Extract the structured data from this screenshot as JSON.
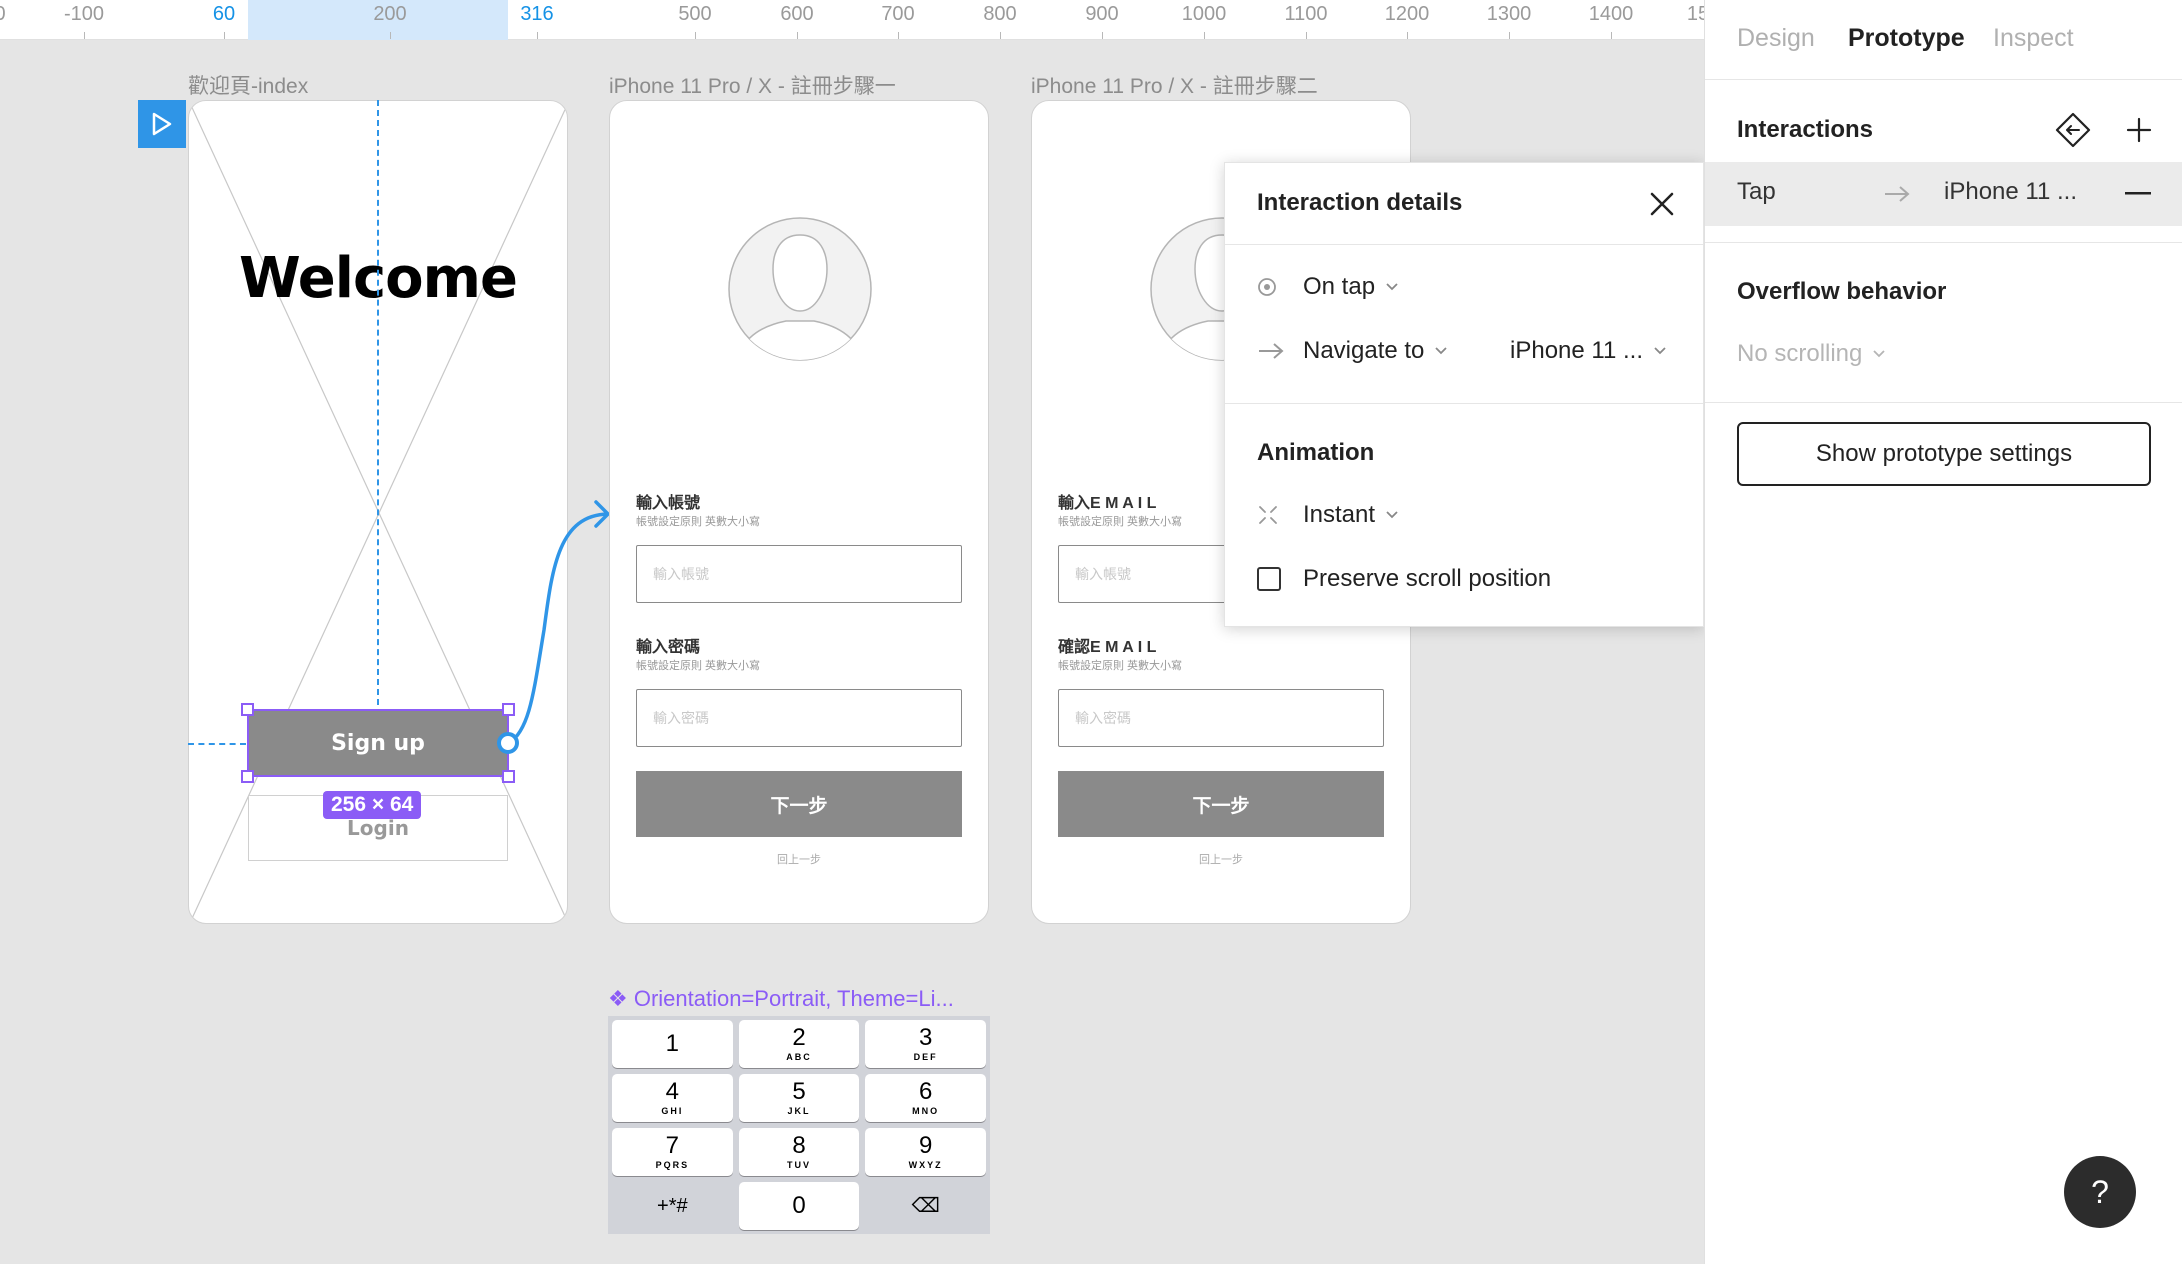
{
  "ruler": {
    "ticks": [
      "0",
      "-100",
      "60",
      "200",
      "316",
      "500",
      "600",
      "700",
      "800",
      "900",
      "1000",
      "1100",
      "1200",
      "1300",
      "1400",
      "15"
    ]
  },
  "frames": {
    "welcome": {
      "title": "歡迎頁-index",
      "heading": "Welcome",
      "signup_label": "Sign up",
      "login_label": "Login",
      "size_badge": "256 × 64"
    },
    "step1": {
      "title": "iPhone 11 Pro / X - 註冊步驟一",
      "field1_label": "輸入帳號",
      "field1_hint": "帳號設定原則 英數大小寫",
      "field1_placeholder": "輸入帳號",
      "field2_label": "輸入密碼",
      "field2_hint": "帳號設定原則 英數大小寫",
      "field2_placeholder": "輸入密碼",
      "next_label": "下一步",
      "back_label": "回上一步"
    },
    "step2": {
      "title": "iPhone 11 Pro / X - 註冊步驟二",
      "field1_label": "輸入E M A I L",
      "field1_hint": "帳號設定原則 英數大小寫",
      "field1_placeholder": "輸入帳號",
      "field2_label": "確認E M A I L",
      "field2_hint": "帳號設定原則 英數大小寫",
      "field2_placeholder": "輸入密碼",
      "next_label": "下一步",
      "back_label": "回上一步"
    }
  },
  "keyboard": {
    "title": "❖ Orientation=Portrait, Theme=Li...",
    "keys": [
      {
        "num": "1",
        "letters": ""
      },
      {
        "num": "2",
        "letters": "ABC"
      },
      {
        "num": "3",
        "letters": "DEF"
      },
      {
        "num": "4",
        "letters": "GHI"
      },
      {
        "num": "5",
        "letters": "JKL"
      },
      {
        "num": "6",
        "letters": "MNO"
      },
      {
        "num": "7",
        "letters": "PQRS"
      },
      {
        "num": "8",
        "letters": "TUV"
      },
      {
        "num": "9",
        "letters": "WXYZ"
      },
      {
        "num": "+*#",
        "letters": ""
      },
      {
        "num": "0",
        "letters": ""
      },
      {
        "num": "⌫",
        "letters": ""
      }
    ]
  },
  "popup": {
    "title": "Interaction details",
    "trigger": "On tap",
    "action": "Navigate to",
    "destination": "iPhone 11 ...",
    "animation_title": "Animation",
    "animation": "Instant",
    "preserve_scroll": "Preserve scroll position",
    "preserve_scroll_checked": false
  },
  "panel": {
    "tabs": [
      "Design",
      "Prototype",
      "Inspect"
    ],
    "active_tab": "Prototype",
    "interactions_title": "Interactions",
    "interaction": {
      "trigger": "Tap",
      "destination": "iPhone 11 ..."
    },
    "overflow_title": "Overflow behavior",
    "overflow_value": "No scrolling",
    "settings_button": "Show prototype settings"
  },
  "help": {
    "label": "?"
  },
  "colors": {
    "accent_blue": "#2f95e7",
    "selection_purple": "#8b5cf6",
    "button_gray": "#8a8a8a",
    "canvas_bg": "#e5e5e5"
  }
}
